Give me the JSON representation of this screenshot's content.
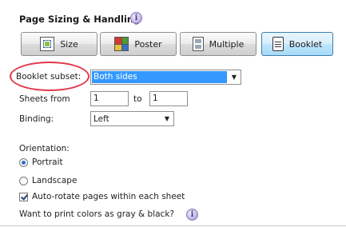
{
  "section": {
    "title": "Page Sizing & Handling",
    "help_icon": "help-icon"
  },
  "buttons": [
    {
      "label": "Size",
      "icon": "size-icon",
      "active": false
    },
    {
      "label": "Poster",
      "icon": "poster-icon",
      "active": false
    },
    {
      "label": "Multiple",
      "icon": "multiple-icon",
      "active": false
    },
    {
      "label": "Booklet",
      "icon": "booklet-icon",
      "active": true
    }
  ],
  "booklet_subset": {
    "label": "Booklet subset:",
    "value": "Both sides"
  },
  "sheets": {
    "label": "Sheets from",
    "from_value": "1",
    "to_label": "to",
    "to_value": "1"
  },
  "binding": {
    "label": "Binding:",
    "value": "Left"
  },
  "orientation": {
    "label": "Orientation:",
    "options": [
      {
        "label": "Portrait",
        "selected": true
      },
      {
        "label": "Landscape",
        "selected": false
      }
    ]
  },
  "auto_rotate": {
    "label": "Auto-rotate pages within each sheet",
    "checked": true
  },
  "gray_print": {
    "label": "Want to print colors as gray & black?"
  },
  "colors": {
    "highlight_ring": "#e2384c",
    "selection": "#3399ff",
    "active_button": "#bee6fd"
  }
}
